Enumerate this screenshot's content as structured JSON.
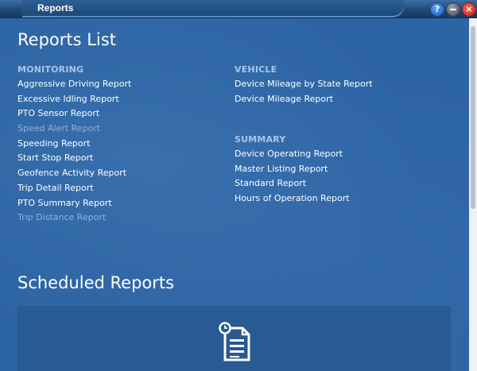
{
  "window": {
    "title": "Reports",
    "help_glyph": "?",
    "close_glyph": "×"
  },
  "reports_list": {
    "heading": "Reports List",
    "monitoring": {
      "heading": "MONITORING",
      "items": [
        {
          "label": "Aggressive Driving Report",
          "enabled": true
        },
        {
          "label": "Excessive Idling Report",
          "enabled": true
        },
        {
          "label": "PTO Sensor Report",
          "enabled": true
        },
        {
          "label": "Speed Alert Report",
          "enabled": false
        },
        {
          "label": "Speeding Report",
          "enabled": true
        },
        {
          "label": "Start Stop Report",
          "enabled": true
        },
        {
          "label": "Geofence Activity Report",
          "enabled": true
        },
        {
          "label": "Trip Detail Report",
          "enabled": true
        },
        {
          "label": "PTO Summary Report",
          "enabled": true
        },
        {
          "label": "Trip Distance Report",
          "enabled": false
        }
      ]
    },
    "vehicle": {
      "heading": "VEHICLE",
      "items": [
        {
          "label": "Device Mileage by State Report",
          "enabled": true
        },
        {
          "label": "Device Mileage Report",
          "enabled": true
        }
      ]
    },
    "summary": {
      "heading": "SUMMARY",
      "items": [
        {
          "label": "Device Operating Report",
          "enabled": true
        },
        {
          "label": "Master Listing Report",
          "enabled": true
        },
        {
          "label": "Standard Report",
          "enabled": true
        },
        {
          "label": "Hours of Operation Report",
          "enabled": true
        }
      ]
    }
  },
  "scheduled_reports": {
    "heading": "Scheduled Reports",
    "icon": "scheduled-document-icon"
  }
}
